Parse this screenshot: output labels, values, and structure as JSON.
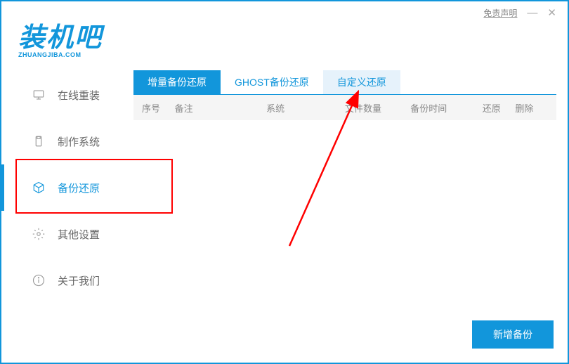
{
  "titlebar": {
    "disclaimer": "免责声明"
  },
  "logo": {
    "text": "装机吧",
    "sub": "ZHUANGJIBA.COM"
  },
  "sidebar": {
    "items": [
      {
        "label": "在线重装"
      },
      {
        "label": "制作系统"
      },
      {
        "label": "备份还原"
      },
      {
        "label": "其他设置"
      },
      {
        "label": "关于我们"
      }
    ]
  },
  "tabs": {
    "items": [
      {
        "label": "增量备份还原"
      },
      {
        "label": "GHOST备份还原"
      },
      {
        "label": "自定义还原"
      }
    ]
  },
  "table": {
    "headers": {
      "seq": "序号",
      "note": "备注",
      "sys": "系统",
      "count": "文件数量",
      "time": "备份时间",
      "restore": "还原",
      "delete": "删除"
    }
  },
  "footer": {
    "add_backup": "新增备份"
  }
}
